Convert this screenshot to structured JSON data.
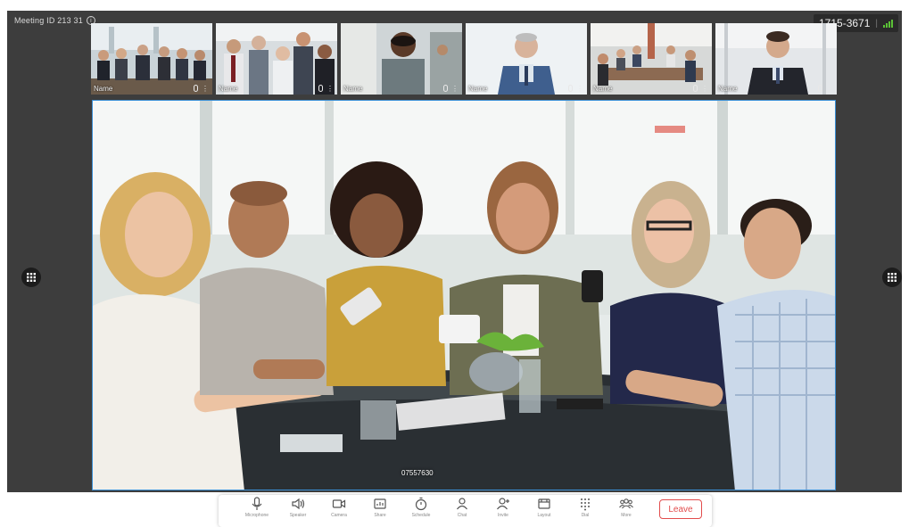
{
  "meeting": {
    "id_label": "Meeting ID 213 31",
    "phone_number": "1715-3671",
    "phone_separator": "|"
  },
  "thumbnails": [
    {
      "label": "Name"
    },
    {
      "label": "Name"
    },
    {
      "label": "Name"
    },
    {
      "label": "Name"
    },
    {
      "label": "Name"
    },
    {
      "label": "Name"
    }
  ],
  "main_video": {
    "participant_id": "07557630"
  },
  "toolbar": {
    "items": [
      {
        "label": "Microphone",
        "icon": "microphone-icon"
      },
      {
        "label": "Speaker",
        "icon": "speaker-icon"
      },
      {
        "label": "Camera",
        "icon": "camera-icon"
      },
      {
        "label": "Share",
        "icon": "share-icon"
      },
      {
        "label": "Schedule",
        "icon": "timer-icon"
      },
      {
        "label": "Chat",
        "icon": "person-icon"
      },
      {
        "label": "Invite",
        "icon": "add-person-icon"
      },
      {
        "label": "Layout",
        "icon": "layout-icon"
      },
      {
        "label": "Dial",
        "icon": "dialpad-icon"
      },
      {
        "label": "More",
        "icon": "participants-icon"
      }
    ],
    "leave_label": "Leave"
  },
  "colors": {
    "accent_border": "#3a8fd6",
    "leave": "#e24c4c",
    "signal": "#5bc236"
  }
}
